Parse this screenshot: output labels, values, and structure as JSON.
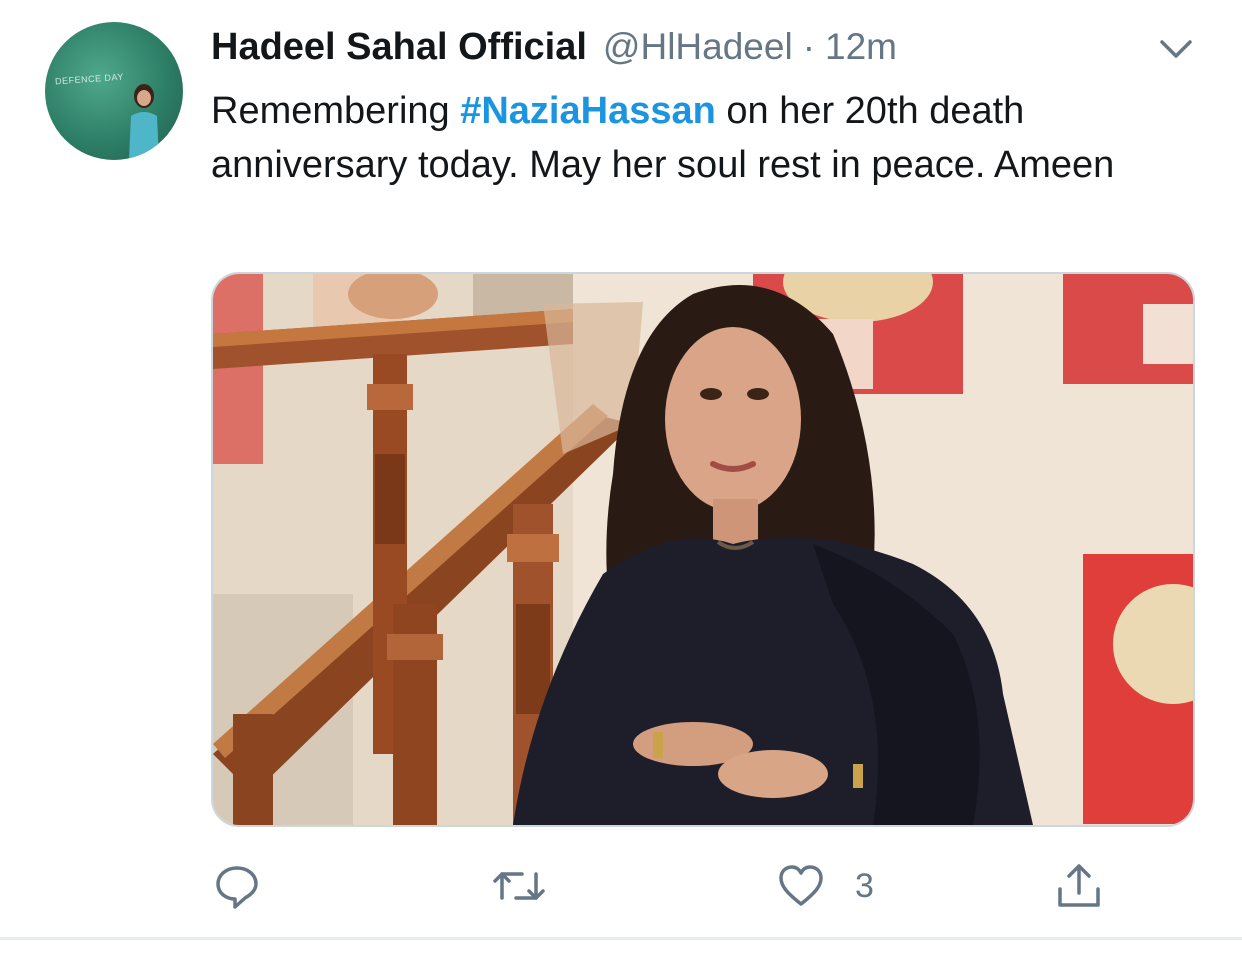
{
  "tweet": {
    "author_name": "Hadeel Sahal Official",
    "author_handle": "@HlHadeel",
    "separator": "·",
    "timestamp": "12m",
    "text_before": "Remembering ",
    "hashtag": "#NaziaHassan",
    "text_after": " on her 20th death anniversary today. May her soul rest in peace. Ameen",
    "avatar_caption": "DEFENCE DAY",
    "media_alt": "Photo of a woman in a black dress seated beside a wooden staircase railing"
  },
  "actions": {
    "reply_icon": "reply-icon",
    "retweet_icon": "retweet-icon",
    "like_icon": "heart-icon",
    "like_count": "3",
    "share_icon": "share-icon"
  },
  "colors": {
    "text": "#14171a",
    "secondary": "#657786",
    "link": "#1b95e0",
    "border": "#ccd6dd"
  }
}
